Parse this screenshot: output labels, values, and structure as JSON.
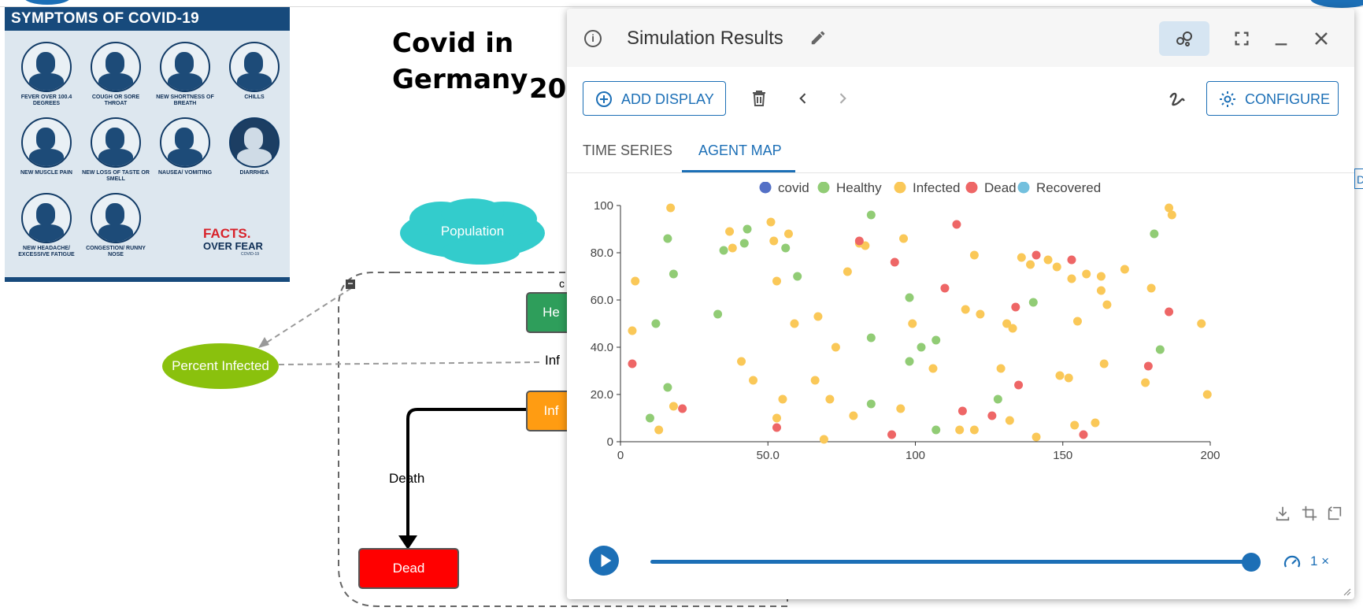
{
  "poster": {
    "title": "SYMPTOMS OF COVID-19",
    "symptoms": [
      "FEVER OVER 100.4 DEGREES",
      "COUGH OR SORE THROAT",
      "NEW SHORTNESS OF BREATH",
      "CHILLS",
      "NEW MUSCLE PAIN",
      "NEW LOSS OF TASTE OR SMELL",
      "NAUSEA/ VOMITING",
      "DIARRHEA",
      "NEW HEADACHE/ EXCESSIVE FATIGUE",
      "CONGESTION/ RUNNY NOSE"
    ],
    "brand_line1": "FACTS.",
    "brand_line2": "OVER FEAR",
    "brand_tag": "COVID-19"
  },
  "model": {
    "title_line1": "Covid in",
    "title_line2": "Germany",
    "title_year_partial": "20",
    "population_label": "Population",
    "percent_infected_label": "Percent Infected",
    "healthy_stock_label": "He",
    "infected_stock_label": "Inf",
    "infection_flow_label": "Inf",
    "dead_stock_label": "Dead",
    "death_flow_label": "Death",
    "collapse_symbol": "−",
    "partial_top_label": "c"
  },
  "panel": {
    "title": "Simulation Results",
    "add_display_label": "ADD DISPLAY",
    "configure_label": "CONFIGURE",
    "tabs": [
      {
        "label": "TIME SERIES",
        "active": false
      },
      {
        "label": "AGENT MAP",
        "active": true
      }
    ],
    "speed_label": "1 ×",
    "slider_fraction": 1.0,
    "edge_button_label": "D"
  },
  "colors": {
    "accent": "#1c6fb6",
    "covid": "#5470c6",
    "healthy": "#91cc75",
    "infected": "#fac858",
    "dead": "#ee6666",
    "recovered": "#73c0de"
  },
  "chart_data": {
    "type": "scatter",
    "xlim": [
      0,
      200
    ],
    "ylim": [
      0,
      100
    ],
    "x_ticks": [
      "0",
      "50.0",
      "100",
      "150",
      "200"
    ],
    "y_ticks": [
      "0",
      "20.0",
      "40.0",
      "60.0",
      "80.0",
      "100"
    ],
    "legend_position": "top-center",
    "series": [
      {
        "name": "covid",
        "color": "#5470c6",
        "points": []
      },
      {
        "name": "Healthy",
        "color": "#91cc75",
        "points": [
          [
            10,
            10
          ],
          [
            12,
            50
          ],
          [
            16,
            23
          ],
          [
            16,
            86
          ],
          [
            18,
            71
          ],
          [
            33,
            54
          ],
          [
            35,
            81
          ],
          [
            42,
            84
          ],
          [
            43,
            90
          ],
          [
            56,
            82
          ],
          [
            60,
            70
          ],
          [
            85,
            96
          ],
          [
            85,
            44
          ],
          [
            85,
            16
          ],
          [
            98,
            34
          ],
          [
            98,
            61
          ],
          [
            102,
            40
          ],
          [
            107,
            5
          ],
          [
            107,
            43
          ],
          [
            128,
            18
          ],
          [
            140,
            59
          ],
          [
            181,
            88
          ],
          [
            183,
            39
          ]
        ]
      },
      {
        "name": "Infected",
        "color": "#fac858",
        "points": [
          [
            4,
            47
          ],
          [
            5,
            68
          ],
          [
            17,
            99
          ],
          [
            18,
            15
          ],
          [
            13,
            5
          ],
          [
            37,
            89
          ],
          [
            38,
            82
          ],
          [
            41,
            34
          ],
          [
            45,
            26
          ],
          [
            51,
            93
          ],
          [
            52,
            85
          ],
          [
            53,
            68
          ],
          [
            53,
            10
          ],
          [
            55,
            18
          ],
          [
            57,
            88
          ],
          [
            59,
            50
          ],
          [
            66,
            26
          ],
          [
            67,
            53
          ],
          [
            69,
            1
          ],
          [
            71,
            18
          ],
          [
            73,
            40
          ],
          [
            77,
            72
          ],
          [
            79,
            11
          ],
          [
            81,
            84
          ],
          [
            83,
            83
          ],
          [
            95,
            14
          ],
          [
            96,
            86
          ],
          [
            99,
            50
          ],
          [
            106,
            31
          ],
          [
            115,
            5
          ],
          [
            117,
            56
          ],
          [
            120,
            5
          ],
          [
            120,
            79
          ],
          [
            122,
            54
          ],
          [
            129,
            31
          ],
          [
            131,
            50
          ],
          [
            132,
            9
          ],
          [
            133,
            48
          ],
          [
            136,
            78
          ],
          [
            139,
            75
          ],
          [
            141,
            2
          ],
          [
            145,
            77
          ],
          [
            148,
            74
          ],
          [
            149,
            28
          ],
          [
            152,
            27
          ],
          [
            153,
            69
          ],
          [
            154,
            7
          ],
          [
            155,
            51
          ],
          [
            158,
            71
          ],
          [
            161,
            8
          ],
          [
            163,
            70
          ],
          [
            163,
            64
          ],
          [
            164,
            33
          ],
          [
            165,
            58
          ],
          [
            171,
            73
          ],
          [
            178,
            25
          ],
          [
            180,
            65
          ],
          [
            186,
            99
          ],
          [
            187,
            96
          ],
          [
            197,
            50
          ],
          [
            199,
            20
          ]
        ]
      },
      {
        "name": "Dead",
        "color": "#ee6666",
        "points": [
          [
            4,
            33
          ],
          [
            21,
            14
          ],
          [
            53,
            6
          ],
          [
            81,
            85
          ],
          [
            92,
            3
          ],
          [
            93,
            76
          ],
          [
            110,
            65
          ],
          [
            114,
            92
          ],
          [
            116,
            13
          ],
          [
            126,
            11
          ],
          [
            134,
            57
          ],
          [
            135,
            24
          ],
          [
            141,
            79
          ],
          [
            153,
            77
          ],
          [
            157,
            3
          ],
          [
            179,
            32
          ],
          [
            186,
            55
          ]
        ]
      },
      {
        "name": "Recovered",
        "color": "#73c0de",
        "points": []
      }
    ]
  }
}
